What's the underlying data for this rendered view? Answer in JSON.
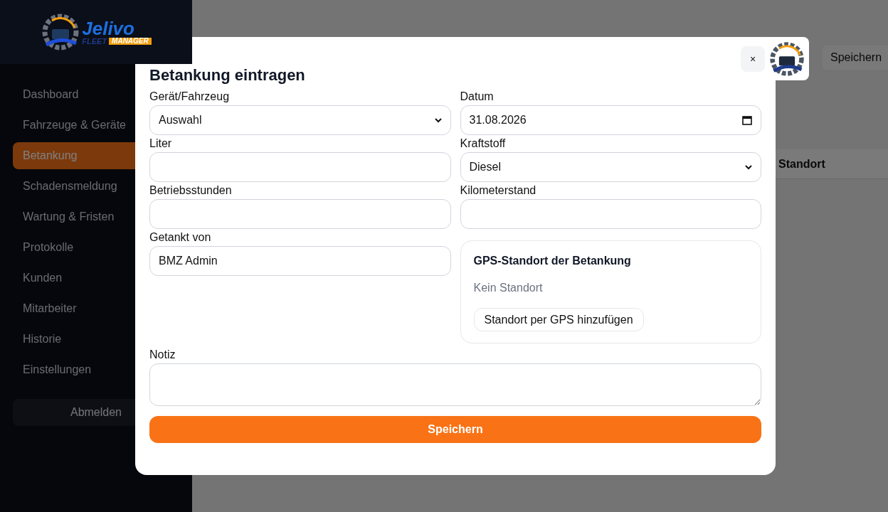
{
  "logo": {
    "name": "Jelivo",
    "line_1": "FLEET",
    "line_2": "MANAGER"
  },
  "sidebar": {
    "nav": [
      {
        "label": "Dashboard",
        "selected": false
      },
      {
        "label": "Fahrzeuge & Geräte",
        "selected": false
      },
      {
        "label": "Betankung",
        "selected": true
      },
      {
        "label": "Schadensmeldung",
        "selected": false
      },
      {
        "label": "Wartung & Fristen",
        "selected": false
      },
      {
        "label": "Protokolle",
        "selected": false
      },
      {
        "label": "Kunden",
        "selected": false
      },
      {
        "label": "Mitarbeiter",
        "selected": false
      },
      {
        "label": "Historie",
        "selected": false
      },
      {
        "label": "Einstellungen",
        "selected": false
      }
    ],
    "logout": "Abmelden"
  },
  "background": {
    "save_button": "Speichern",
    "table_header": "Standort"
  },
  "modal": {
    "title": "Betankung eintragen",
    "close": "×",
    "fields": [
      {
        "kind": "select",
        "label": "Gerät/Fahrzeug",
        "value": "Auswahl"
      },
      {
        "kind": "date",
        "label": "Datum",
        "value": "31.08.2026"
      },
      {
        "kind": "input",
        "label": "Liter"
      },
      {
        "kind": "select",
        "label": "Kraftstoff",
        "value": "Diesel"
      },
      {
        "kind": "input",
        "label": "Betriebsstunden"
      },
      {
        "kind": "input",
        "label": "Kilometerstand"
      },
      {
        "kind": "input",
        "label": "Getankt von",
        "value": "BMZ Admin"
      },
      {
        "kind": "gps",
        "title": "GPS-Standort der Betankung",
        "status": "Kein Standort",
        "button": "Standort per GPS hinzufügen"
      }
    ],
    "note": {
      "label": "Notiz"
    },
    "submit": "Speichern"
  }
}
